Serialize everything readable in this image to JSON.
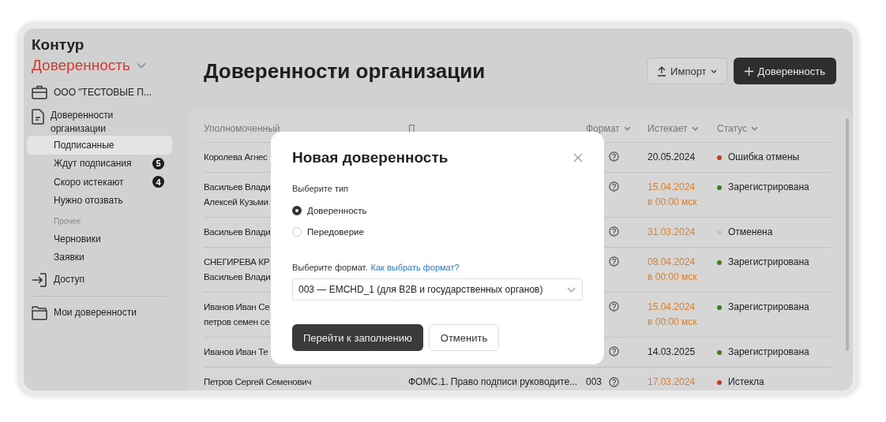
{
  "sidebar": {
    "brand": "Контур",
    "product": "Доверенность",
    "org": "ООО \"ТЕСТОВЫЕ П...",
    "group": {
      "label": "Доверенности организации",
      "items": [
        {
          "label": "Подписанные",
          "selected": true
        },
        {
          "label": "Ждут подписания",
          "selected": false,
          "badge": "5"
        },
        {
          "label": "Скоро истекают",
          "selected": false,
          "badge": "4"
        },
        {
          "label": "Нужно отозвать",
          "selected": false
        }
      ]
    },
    "other_heading": "Прочее",
    "other_items": [
      {
        "label": "Черновики",
        "selected": false
      },
      {
        "label": "Заявки",
        "selected": false
      }
    ],
    "access": "Доступ",
    "my": "Мои доверенности"
  },
  "header": {
    "title": "Доверенности организации",
    "import_button": "Импорт",
    "new_button": "Доверенность"
  },
  "table": {
    "columns": [
      "Уполномоченный",
      "П",
      "Формат",
      "Истекает",
      "Статус"
    ],
    "rows": [
      {
        "person": [
          "Королева Агнес"
        ],
        "expires": [
          "20.05.2024"
        ],
        "expiring": false,
        "status": "Ошибка отмены",
        "color": "#c0392b"
      },
      {
        "person": [
          "Васильев Влади",
          "Алексей Кузьми"
        ],
        "expires": [
          "15.04.2024",
          "в 00:00 мск"
        ],
        "expiring": true,
        "status": "Зарегистрирована",
        "color": "#3f7d20"
      },
      {
        "person": [
          "Васильев Влади"
        ],
        "expires": [
          "31.03.2024"
        ],
        "expiring": true,
        "status": "Отменена",
        "color": "#c4c4c4"
      },
      {
        "person": [
          "СНЕГИРЕВА КР",
          "Васильев Влади"
        ],
        "expires": [
          "08.04.2024",
          "в 00:00 мск"
        ],
        "expiring": true,
        "status": "Зарегистрирована",
        "color": "#3f7d20"
      },
      {
        "person": [
          "Иванов Иван Се",
          "петров семен се"
        ],
        "expires": [
          "15.04.2024",
          "в 00:00 мск"
        ],
        "expiring": true,
        "status": "Зарегистрирована",
        "color": "#3f7d20"
      },
      {
        "person": [
          "Иванов Иван Те"
        ],
        "expires": [
          "14.03.2025"
        ],
        "expiring": false,
        "status": "Зарегистрирована",
        "color": "#3f7d20"
      },
      {
        "person": [
          "Петров Сергей Семенович"
        ],
        "topic": "ФОМС.1. Право подписи руководите...",
        "format": "003",
        "expires": [
          "17.03.2024"
        ],
        "expiring": true,
        "status": "Истекла",
        "color": "#c0392b"
      }
    ]
  },
  "modal": {
    "title": "Новая доверенность",
    "type_label": "Выберите тип",
    "options": [
      {
        "label": "Доверенность",
        "selected": true
      },
      {
        "label": "Передоверие",
        "selected": false
      }
    ],
    "format_label": "Выберите формат.",
    "help_link": "Как выбрать формат?",
    "format_value": "003 — EMCHD_1 (для B2B и государственных органов)",
    "primary_button": "Перейти к заполнению",
    "secondary_button": "Отменить"
  }
}
